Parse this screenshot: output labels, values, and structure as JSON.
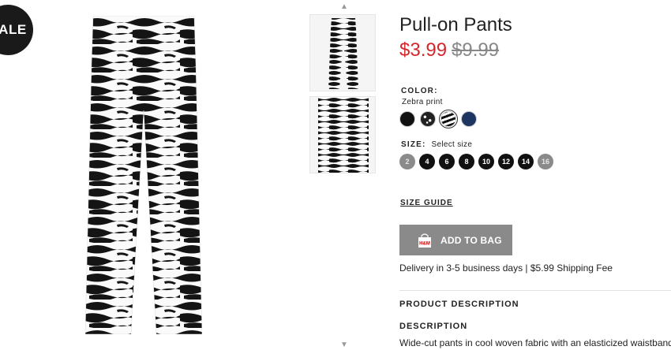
{
  "badge": {
    "label": "SALE"
  },
  "gallery": {
    "up_arrow": "▲",
    "down_arrow": "▼"
  },
  "product": {
    "title": "Pull-on Pants",
    "sale_price": "$3.99",
    "original_price": "$9.99"
  },
  "color": {
    "label": "COLOR:",
    "selected_value": "Zebra print",
    "swatches": [
      {
        "name": "Black",
        "color": "#111111"
      },
      {
        "name": "Black dotted",
        "color": "#222222"
      },
      {
        "name": "Zebra print",
        "color": "#ffffff",
        "selected": true
      },
      {
        "name": "Dark blue",
        "color": "#1d3560"
      }
    ]
  },
  "size": {
    "label": "SIZE:",
    "placeholder": "Select size",
    "options": [
      {
        "label": "2",
        "available": false
      },
      {
        "label": "4",
        "available": true
      },
      {
        "label": "6",
        "available": true
      },
      {
        "label": "8",
        "available": true
      },
      {
        "label": "10",
        "available": true
      },
      {
        "label": "12",
        "available": true
      },
      {
        "label": "14",
        "available": true
      },
      {
        "label": "16",
        "available": false
      }
    ]
  },
  "size_guide": {
    "label": "SIZE GUIDE"
  },
  "add_to_bag": {
    "label": "ADD TO BAG",
    "icon": "shopping-bag-icon",
    "icon_text": "H&M"
  },
  "delivery": {
    "text": "Delivery in 3-5 business days | $5.99 Shipping Fee"
  },
  "product_description": {
    "heading": "PRODUCT DESCRIPTION",
    "sub_heading": "DESCRIPTION",
    "text": "Wide-cut pants in cool woven fabric with an elasticized waistband"
  },
  "colors": {
    "sale_price": "#d6262b",
    "button": "#8a8a8a"
  }
}
